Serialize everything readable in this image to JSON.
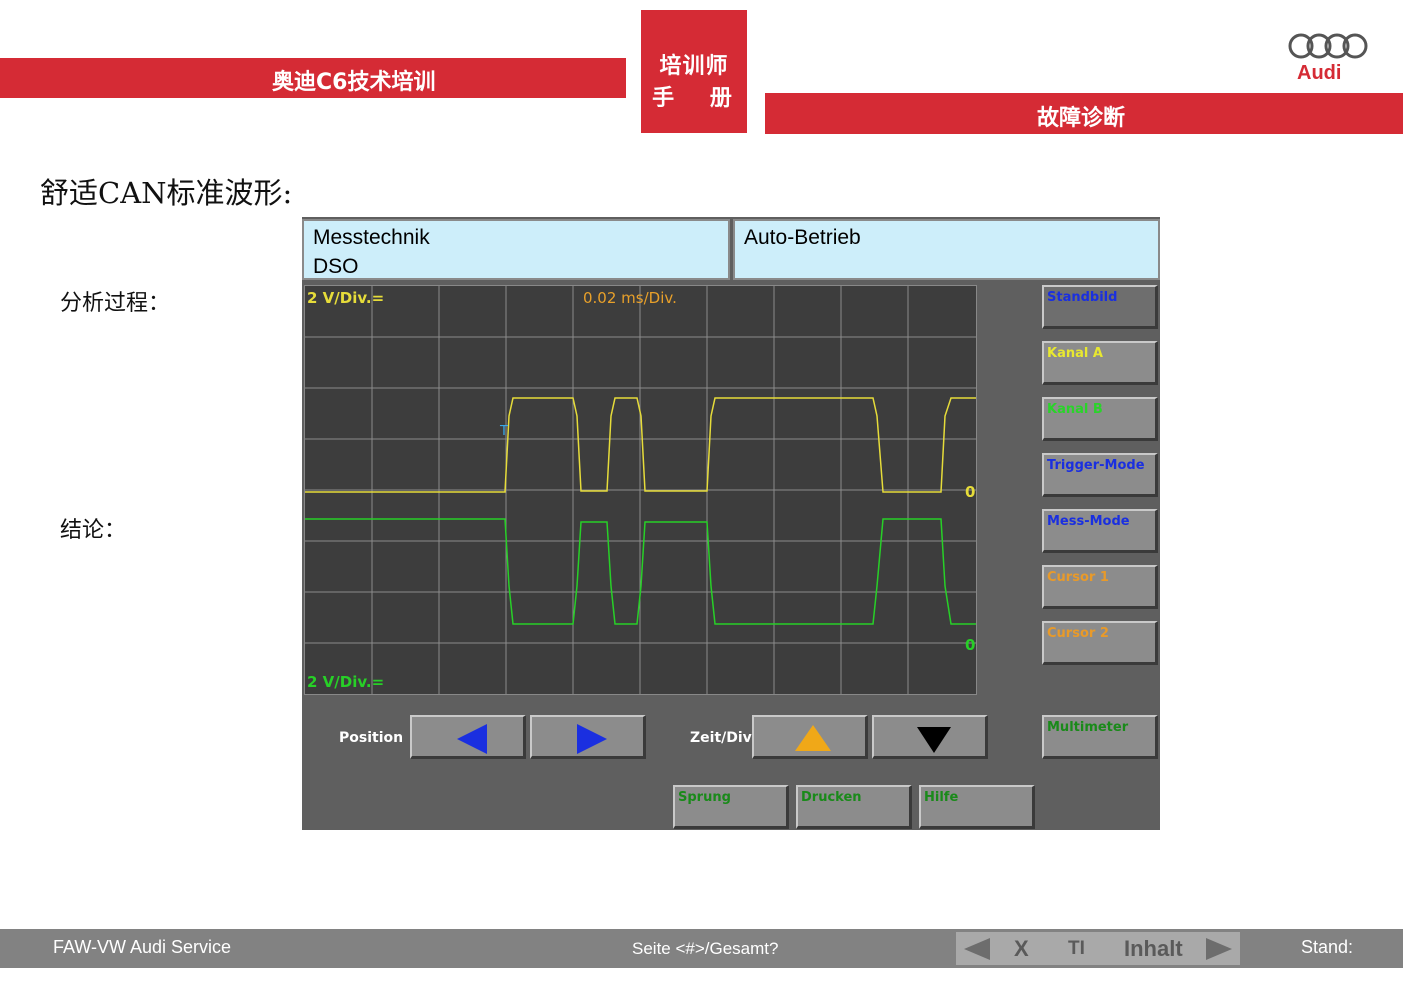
{
  "header": {
    "left_title": "奥迪C6技术培训",
    "center_line1": "培训师",
    "center_line2": "手 册",
    "right_title": "故障诊断",
    "brand": "Audi",
    "brand_color": "#d52b35"
  },
  "content": {
    "title": "舒适CAN标准波形:",
    "analysis_label": "分析过程：",
    "conclusion_label": "结论："
  },
  "tester": {
    "info_left_line1": "Messtechnik",
    "info_left_line2": "DSO",
    "info_right": "Auto-Betrieb",
    "scale_ch_a": "2 V/Div.=",
    "scale_ch_b": "2 V/Div.=",
    "time_base": "0.02 ms/Div.",
    "trigger_marker": "T",
    "zero_a": "0",
    "zero_b": "0",
    "side_buttons": [
      {
        "label": "Standbild",
        "color": "#1a2fe0"
      },
      {
        "label": "Kanal A",
        "color": "#e8e830"
      },
      {
        "label": "Kanal B",
        "color": "#2ad42a"
      },
      {
        "label": "Trigger-Mode",
        "color": "#1a2fe0"
      },
      {
        "label": "Mess-Mode",
        "color": "#1a2fe0"
      },
      {
        "label": "Cursor 1",
        "color": "#e89a2a"
      },
      {
        "label": "Cursor 2",
        "color": "#e89a2a"
      }
    ],
    "multimeter": "Multimeter",
    "position_label": "Position",
    "zeit_label": "Zeit/Div.",
    "bottom_buttons": [
      "Sprung",
      "Drucken",
      "Hilfe"
    ],
    "channel_a_color": "#e6dc3a",
    "channel_b_color": "#27d027"
  },
  "footer": {
    "left": "FAW-VW Audi Service",
    "center": "Seite <#>/Gesamt?",
    "nav_x": "X",
    "nav_t": "TI",
    "nav_inhalt": "Inhalt",
    "stand": "Stand:"
  }
}
